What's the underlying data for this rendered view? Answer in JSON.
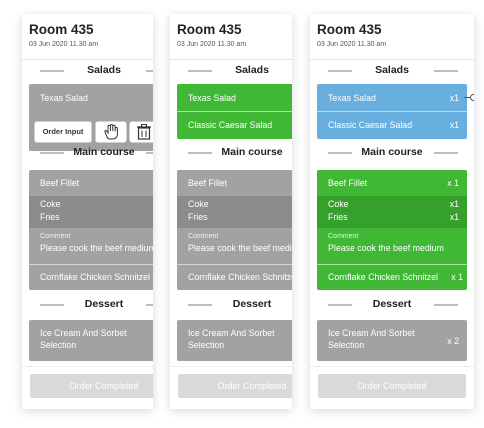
{
  "room": "Room  435",
  "date": "03 Jun 2020  11.30 am",
  "sections": {
    "salads": "Salads",
    "main": "Main course",
    "dessert": "Dessert"
  },
  "items": {
    "texas": "Texas Salad",
    "caesar": "Classic Caesar Salad",
    "beef": "Beef Fillet",
    "coke": "Coke",
    "fries": "Fries",
    "comment_label": "Comment",
    "comment_text": "Please cook the beef medium",
    "schnitzel": "Cornflake Chicken Schnitzel",
    "dessert_line1": "Ice Cream And Sorbet",
    "dessert_line2": "Selection"
  },
  "quantities": {
    "texas": "x1",
    "caesar": "x1",
    "beef": "x 1",
    "coke": "x1",
    "fries": "x1",
    "schnitzel": "x 1",
    "dessert": "x 2"
  },
  "toolbar": {
    "order_input": "Order Input"
  },
  "button": {
    "order_completed": "Order Completed"
  },
  "colors": {
    "grey": "#a2a2a2",
    "green": "#40b835",
    "blue": "#68aede",
    "disabled_button": "#d9d9d9"
  }
}
